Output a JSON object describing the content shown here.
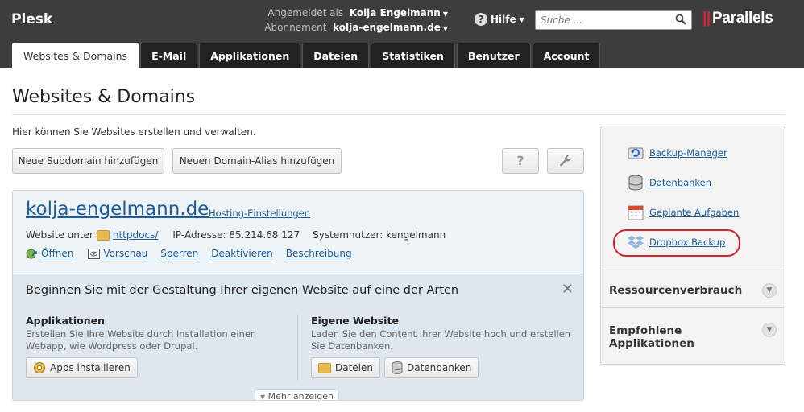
{
  "header": {
    "brand": "Plesk",
    "logged_in_label": "Angemeldet als",
    "logged_in_user": "Kolja Engelmann",
    "subscription_label": "Abonnement",
    "subscription_value": "kolja-engelmann.de",
    "help_label": "Hilfe",
    "search_placeholder": "Suche ...",
    "vendor_logo": "Parallels"
  },
  "tabs": [
    {
      "label": "Websites & Domains",
      "active": true
    },
    {
      "label": "E-Mail",
      "active": false
    },
    {
      "label": "Applikationen",
      "active": false
    },
    {
      "label": "Dateien",
      "active": false
    },
    {
      "label": "Statistiken",
      "active": false
    },
    {
      "label": "Benutzer",
      "active": false
    },
    {
      "label": "Account",
      "active": false
    }
  ],
  "page": {
    "title": "Websites & Domains",
    "intro": "Hier können Sie Websites erstellen und verwalten.",
    "add_subdomain": "Neue Subdomain hinzufügen",
    "add_alias": "Neuen Domain-Alias hinzufügen",
    "help_button": "?"
  },
  "domain": {
    "name": "kolja-engelmann.de",
    "hosting_link": "Hosting-Einstellungen",
    "website_under_label": "Website unter",
    "folder": "httpdocs/",
    "ip_text": "IP-Adresse: 85.214.68.127",
    "system_user_text": "Systemnutzer: kengelmann",
    "actions": {
      "open": "Öffnen",
      "preview": "Vorschau",
      "lock": "Sperren",
      "disable": "Deaktivieren",
      "describe": "Beschreibung"
    },
    "getting_started": {
      "title": "Beginnen Sie mit der Gestaltung Ihrer eigenen Website auf eine der Arten",
      "close": "✕",
      "apps_title": "Applikationen",
      "apps_desc_1": "Erstellen Sie Ihre Website durch Installation einer",
      "apps_desc_2": "Webapp, wie Wordpress oder Drupal.",
      "apps_button": "Apps installieren",
      "own_title": "Eigene Website",
      "own_desc_1": "Laden Sie den Content Ihrer Website hoch und erstellen",
      "own_desc_2": "Sie Datenbanken.",
      "files_button": "Dateien",
      "db_button": "Datenbanken",
      "more": "Mehr anzeigen"
    }
  },
  "sidebar": {
    "links": [
      {
        "label": "Backup-Manager",
        "icon": "backup-icon"
      },
      {
        "label": "Datenbanken",
        "icon": "database-icon"
      },
      {
        "label": "Geplante Aufgaben",
        "icon": "calendar-icon"
      },
      {
        "label": "Dropbox Backup",
        "icon": "dropbox-icon"
      }
    ],
    "resource_usage": "Ressourcenverbrauch",
    "recommended_1": "Empfohlene",
    "recommended_2": "Applikationen"
  },
  "colors": {
    "header_bg": "#3d3d3d",
    "link": "#1a5c9c",
    "highlight": "#d32430"
  }
}
